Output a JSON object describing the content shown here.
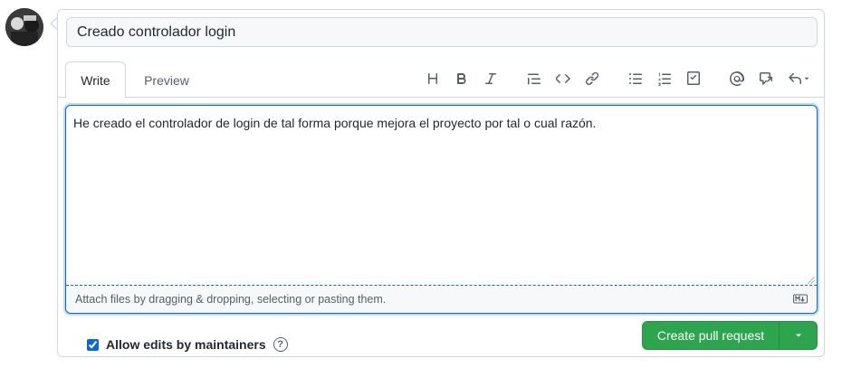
{
  "title_field": {
    "value": "Creado controlador login"
  },
  "tabs": [
    {
      "label": "Write"
    },
    {
      "label": "Preview"
    }
  ],
  "toolbar": {
    "icons": [
      "heading-icon",
      "bold-icon",
      "italic-icon",
      "quote-icon",
      "code-icon",
      "link-icon",
      "unordered-list-icon",
      "ordered-list-icon",
      "task-list-icon",
      "mention-icon",
      "cross-reference-icon",
      "saved-replies-icon"
    ]
  },
  "body_field": {
    "value": "He creado el controlador de login de tal forma porque mejora el proyecto por tal o cual razón."
  },
  "attach": {
    "text": "Attach files by dragging & dropping, selecting or pasting them."
  },
  "footer": {
    "allow_edits_label": "Allow edits by maintainers",
    "allow_edits_checked": true,
    "help_glyph": "?",
    "create_button_label": "Create pull request"
  },
  "colors": {
    "accent": "#0969da",
    "primary_button": "#2da44e",
    "border": "#d0d7de",
    "muted_text": "#57606a"
  }
}
